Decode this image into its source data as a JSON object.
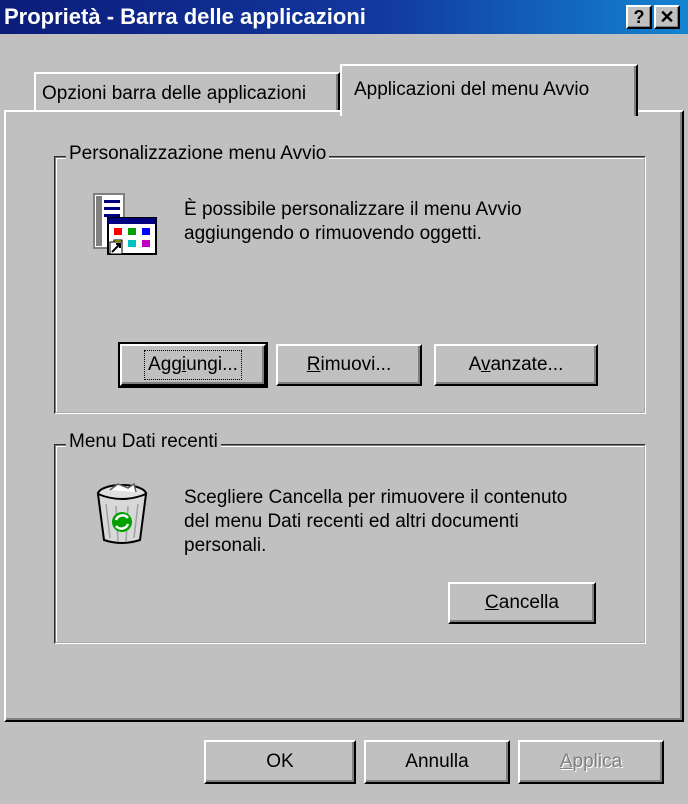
{
  "window": {
    "title": "Proprietà - Barra delle applicazioni",
    "help_button": "?",
    "close_button": "✕"
  },
  "tabs": [
    {
      "label": "Opzioni barra delle applicazioni",
      "selected": false
    },
    {
      "label": "Applicazioni del menu Avvio",
      "selected": true
    }
  ],
  "start_menu_group": {
    "legend": "Personalizzazione menu Avvio",
    "icon": "start-menu-icon",
    "description_line1": "È possibile personalizzare il menu Avvio",
    "description_line2": "aggiungendo o rimuovendo oggetti.",
    "buttons": {
      "add": {
        "label": "Aggiungi...",
        "mnemonic": "g"
      },
      "remove": {
        "label": "Rimuovi...",
        "mnemonic": "R"
      },
      "advanced": {
        "label": "Avanzate...",
        "mnemonic": "v"
      }
    }
  },
  "recent_docs_group": {
    "legend": "Menu Dati recenti",
    "icon": "recycle-bin-icon",
    "description_line1": "Scegliere Cancella per rimuovere il contenuto",
    "description_line2": "del menu Dati recenti ed altri documenti",
    "description_line3": "personali.",
    "clear_button": {
      "label": "Cancella",
      "mnemonic": "C"
    }
  },
  "dialog_buttons": {
    "ok": "OK",
    "cancel": "Annulla",
    "apply": {
      "label": "Applica",
      "mnemonic": "A",
      "enabled": false
    }
  },
  "colors": {
    "face": "#c0c0c0",
    "title_start": "#0b1c79",
    "title_end": "#1384d1",
    "shadow": "#808080",
    "highlight": "#ffffff"
  }
}
